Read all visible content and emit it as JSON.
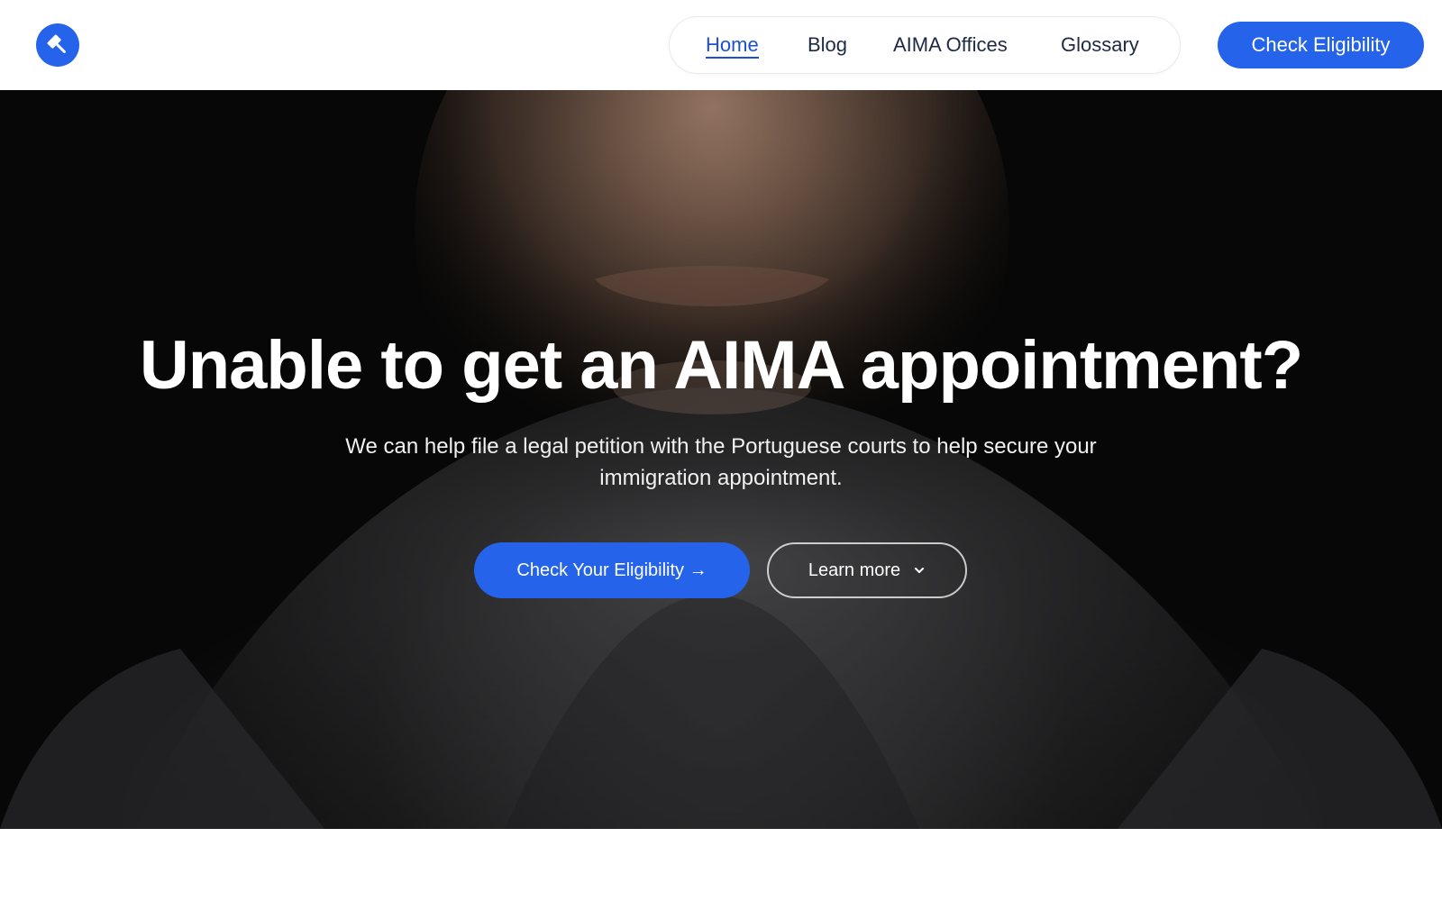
{
  "brand": {
    "logo_icon": "gavel-icon",
    "accent_color": "#2563eb"
  },
  "nav": {
    "items": [
      {
        "label": "Home",
        "active": true
      },
      {
        "label": "Blog",
        "active": false
      },
      {
        "label": "AIMA Offices",
        "active": false
      },
      {
        "label": "Glossary",
        "active": false
      }
    ]
  },
  "header": {
    "cta_label": "Check Eligibility"
  },
  "hero": {
    "title": "Unable to get an AIMA appointment?",
    "subtitle": "We can help file a legal petition with the Portuguese courts to help secure your immigration appointment.",
    "primary_button": "Check Your Eligibility →",
    "secondary_button": "Learn more",
    "secondary_icon": "chevron-down-icon",
    "background_image": "man-in-knit-sweater-photo"
  }
}
